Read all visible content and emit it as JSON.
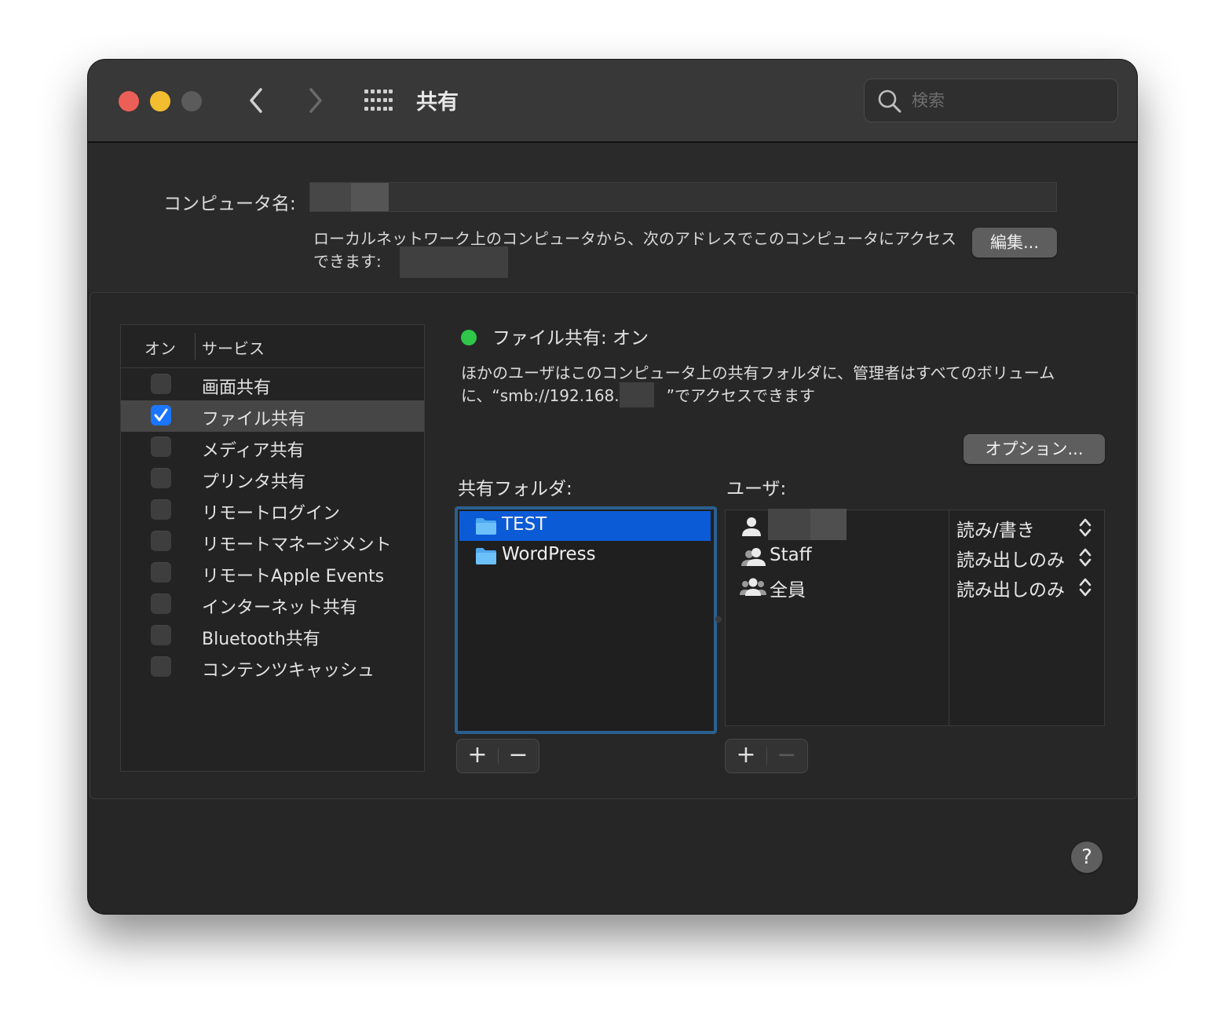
{
  "window": {
    "title": "共有"
  },
  "search": {
    "placeholder": "検索"
  },
  "computer_name": {
    "label": "コンピュータ名:",
    "address_text": "ローカルネットワーク上のコンピュータから、次のアドレスでこのコンピュータにアクセスできます:",
    "edit_button": "編集..."
  },
  "services": {
    "header_on": "オン",
    "header_service": "サービス",
    "items": [
      {
        "label": "画面共有",
        "checked": false
      },
      {
        "label": "ファイル共有",
        "checked": true
      },
      {
        "label": "メディア共有",
        "checked": false
      },
      {
        "label": "プリンタ共有",
        "checked": false
      },
      {
        "label": "リモートログイン",
        "checked": false
      },
      {
        "label": "リモートマネージメント",
        "checked": false
      },
      {
        "label": "リモートApple Events",
        "checked": false
      },
      {
        "label": "インターネット共有",
        "checked": false
      },
      {
        "label": "Bluetooth共有",
        "checked": false
      },
      {
        "label": "コンテンツキャッシュ",
        "checked": false
      }
    ]
  },
  "file_sharing": {
    "status": "ファイル共有: オン",
    "status_color": "#2fc64a",
    "description": "ほかのユーザはこのコンピュータ上の共有フォルダに、管理者はすべてのボリュームに、“smb://192.168.　　　”でアクセスできます",
    "options_button": "オプション...",
    "shared_folders_label": "共有フォルダ:",
    "users_label": "ユーザ:",
    "folders": [
      {
        "name": "TEST",
        "selected": true
      },
      {
        "name": "WordPress",
        "selected": false
      }
    ],
    "users": [
      {
        "name": "",
        "icon": "single-user-icon",
        "permission": "読み/書き"
      },
      {
        "name": "Staff",
        "icon": "group-icon",
        "permission": "読み出しのみ"
      },
      {
        "name": "全員",
        "icon": "everyone-icon",
        "permission": "読み出しのみ"
      }
    ],
    "add_symbol": "+",
    "remove_symbol": "−"
  },
  "help": {
    "label": "?"
  },
  "colors": {
    "accent": "#0b5bd6",
    "checkbox_checked": "#1a75ff"
  }
}
